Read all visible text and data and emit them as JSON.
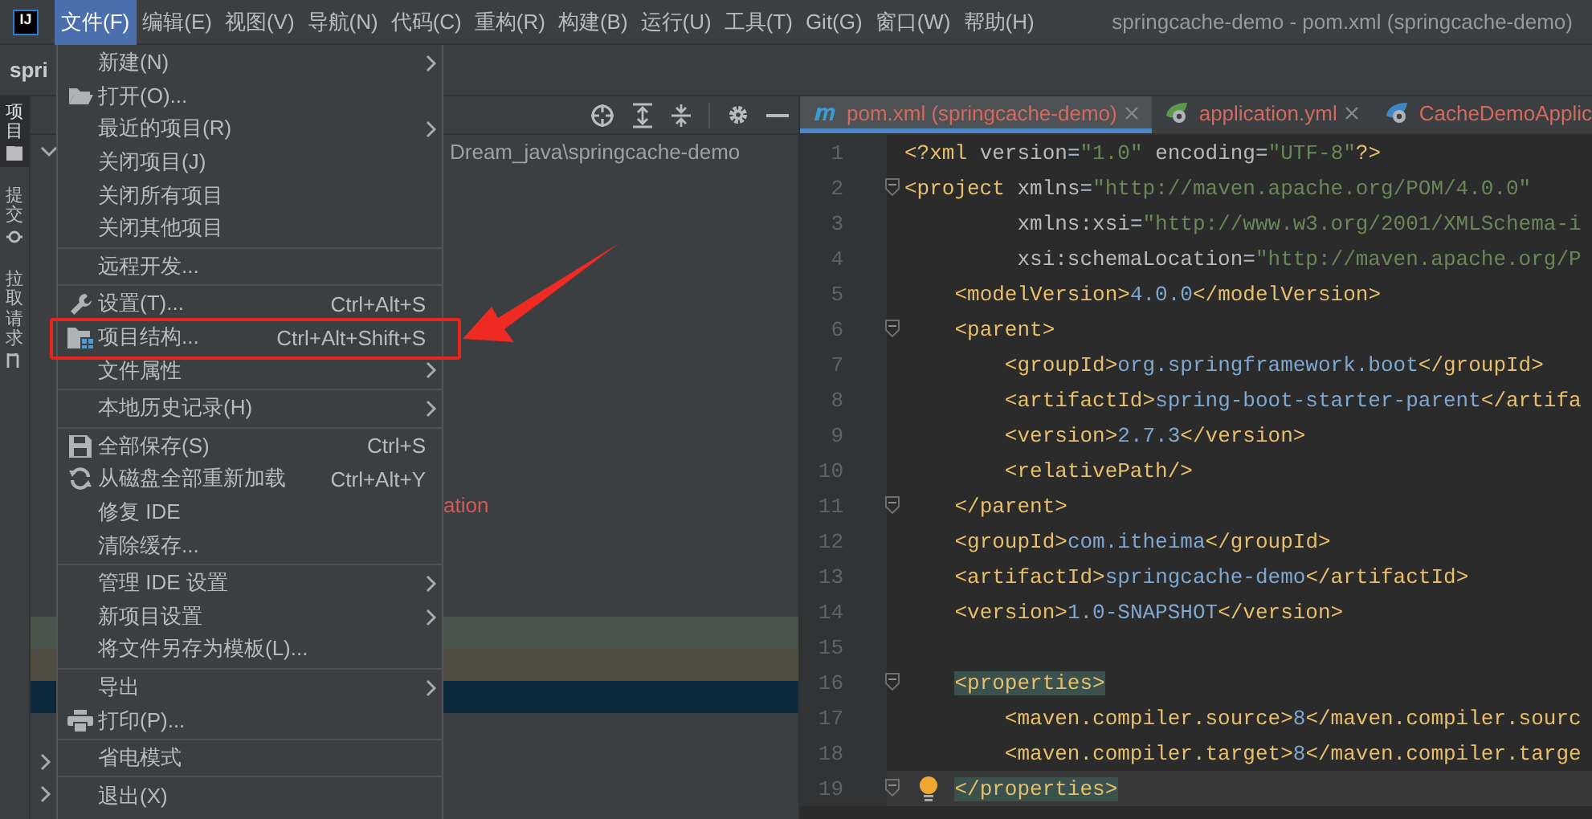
{
  "app": {
    "logo": "IJ",
    "window_title": "springcache-demo - pom.xml (springcache-demo)",
    "breadcrumb": "spri"
  },
  "menu_bar": [
    {
      "label": "文件(F)",
      "selected": true
    },
    {
      "label": "编辑(E)",
      "selected": false
    },
    {
      "label": "视图(V)",
      "selected": false
    },
    {
      "label": "导航(N)",
      "selected": false
    },
    {
      "label": "代码(C)",
      "selected": false
    },
    {
      "label": "重构(R)",
      "selected": false
    },
    {
      "label": "构建(B)",
      "selected": false
    },
    {
      "label": "运行(U)",
      "selected": false
    },
    {
      "label": "工具(T)",
      "selected": false
    },
    {
      "label": "Git(G)",
      "selected": false
    },
    {
      "label": "窗口(W)",
      "selected": false
    },
    {
      "label": "帮助(H)",
      "selected": false
    }
  ],
  "tool_strip": [
    {
      "label": "项目",
      "selected": true
    },
    {
      "label": "提交",
      "selected": false
    },
    {
      "label": "拉取请求",
      "selected": false
    }
  ],
  "project_tree": [
    {
      "kind": "node",
      "expanded": true,
      "text": "Dream_java\\springcache-demo"
    },
    {
      "kind": "blank"
    },
    {
      "kind": "blank"
    },
    {
      "kind": "blank"
    },
    {
      "kind": "blank"
    },
    {
      "kind": "blank"
    },
    {
      "kind": "blank"
    },
    {
      "kind": "blank"
    },
    {
      "kind": "blank"
    },
    {
      "kind": "blank"
    },
    {
      "kind": "blank"
    },
    {
      "kind": "label",
      "error": true,
      "text": "ation"
    },
    {
      "kind": "blank"
    },
    {
      "kind": "blank"
    },
    {
      "kind": "blank"
    },
    {
      "kind": "band",
      "color": "#49544a"
    },
    {
      "kind": "band",
      "color": "#4f4b41"
    },
    {
      "kind": "band",
      "color": "#0d293e"
    },
    {
      "kind": "blank"
    },
    {
      "kind": "node",
      "expanded": false
    },
    {
      "kind": "node",
      "expanded": false
    }
  ],
  "editor_tabs": [
    {
      "label": "pom.xml (springcache-demo)",
      "selected": true,
      "closable": true
    },
    {
      "label": "application.yml",
      "selected": false,
      "closable": true
    },
    {
      "label": "CacheDemoApplic",
      "selected": false,
      "closable": false
    }
  ],
  "code": [
    {
      "number": "1",
      "text": "<?xml version=\"1.0\" encoding=\"UTF-8\"?>"
    },
    {
      "number": "2",
      "text": "<project xmlns=\"http://maven.apache.org/POM/4.0.0\"",
      "fold": true
    },
    {
      "number": "3",
      "text": "         xmlns:xsi=\"http://www.w3.org/2001/XMLSchema-i"
    },
    {
      "number": "4",
      "text": "         xsi:schemaLocation=\"http://maven.apache.org/P"
    },
    {
      "number": "5",
      "text": "    <modelVersion>4.0.0</modelVersion>"
    },
    {
      "number": "6",
      "text": "    <parent>",
      "fold": true
    },
    {
      "number": "7",
      "text": "        <groupId>org.springframework.boot</groupId>"
    },
    {
      "number": "8",
      "text": "        <artifactId>spring-boot-starter-parent</artifa"
    },
    {
      "number": "9",
      "text": "        <version>2.7.3</version>"
    },
    {
      "number": "10",
      "text": "        <relativePath/>"
    },
    {
      "number": "11",
      "text": "    </parent>",
      "fold": true
    },
    {
      "number": "12",
      "text": "    <groupId>com.itheima</groupId>"
    },
    {
      "number": "13",
      "text": "    <artifactId>springcache-demo</artifactId>"
    },
    {
      "number": "14",
      "text": "    <version>1.0-SNAPSHOT</version>"
    },
    {
      "number": "15"
    },
    {
      "number": "16",
      "text": "    <properties>",
      "fold": true,
      "matched": true
    },
    {
      "number": "17",
      "text": "        <maven.compiler.source>8</maven.compiler.sourc"
    },
    {
      "number": "18",
      "text": "        <maven.compiler.target>8</maven.compiler.targe"
    },
    {
      "number": "19",
      "text": "    </properties>",
      "fold": true,
      "matched": true,
      "current": true,
      "hint": true
    }
  ],
  "file_menu": {
    "groups": [
      [
        {
          "label": "新建(N)",
          "submenu": true
        },
        {
          "label": "打开(O)...",
          "submenu": false
        },
        {
          "label": "最近的项目(R)",
          "submenu": true
        },
        {
          "label": "关闭项目(J)",
          "submenu": false
        },
        {
          "label": "关闭所有项目",
          "submenu": false
        },
        {
          "label": "关闭其他项目",
          "submenu": false
        }
      ],
      [
        {
          "label": "远程开发...",
          "submenu": false
        }
      ],
      [
        {
          "label": "设置(T)...",
          "shortcut": "Ctrl+Alt+S",
          "submenu": false
        },
        {
          "label": "项目结构...",
          "shortcut": "Ctrl+Alt+Shift+S",
          "submenu": false,
          "annotated": true
        },
        {
          "label": "文件属性",
          "submenu": true
        }
      ],
      [
        {
          "label": "本地历史记录(H)",
          "submenu": true
        }
      ],
      [
        {
          "label": "全部保存(S)",
          "shortcut": "Ctrl+S",
          "submenu": false
        },
        {
          "label": "从磁盘全部重新加载",
          "shortcut": "Ctrl+Alt+Y",
          "submenu": false
        },
        {
          "label": "修复 IDE",
          "submenu": false
        },
        {
          "label": "清除缓存...",
          "submenu": false
        }
      ],
      [
        {
          "label": "管理 IDE 设置",
          "submenu": true
        },
        {
          "label": "新项目设置",
          "submenu": true
        },
        {
          "label": "将文件另存为模板(L)...",
          "submenu": false
        }
      ],
      [
        {
          "label": "导出",
          "submenu": true
        },
        {
          "label": "打印(P)...",
          "submenu": false
        }
      ],
      [
        {
          "label": "省电模式",
          "submenu": false
        }
      ],
      [
        {
          "label": "退出(X)",
          "submenu": false
        }
      ]
    ]
  }
}
